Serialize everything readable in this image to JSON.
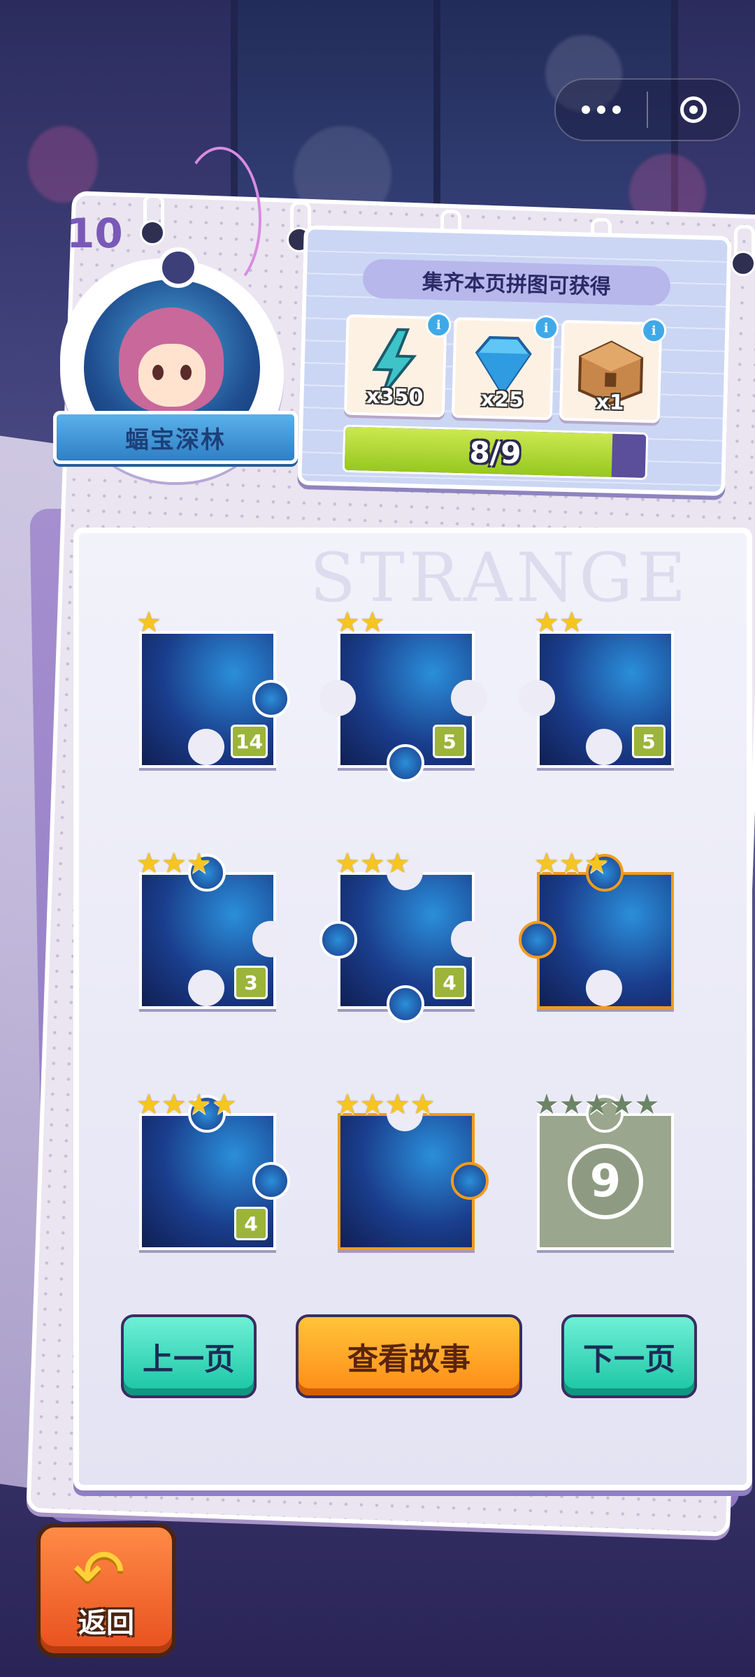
{
  "page": {
    "number": "10",
    "watermark": "STRANGE"
  },
  "avatar": {
    "label": "蝠宝深林"
  },
  "reward": {
    "title": "集齐本页拼图可获得",
    "items": [
      {
        "icon": "lightning-icon",
        "qty": "x350",
        "info": "i"
      },
      {
        "icon": "diamond-icon",
        "qty": "x25",
        "info": "i"
      },
      {
        "icon": "treasure-chest-icon",
        "qty": "x1",
        "info": "i"
      }
    ],
    "progress": {
      "text": "8/9",
      "fraction": 0.889
    }
  },
  "pieces": [
    {
      "stars": 1,
      "count": "14"
    },
    {
      "stars": 2,
      "count": "5"
    },
    {
      "stars": 2,
      "count": "5"
    },
    {
      "stars": 3,
      "count": "3"
    },
    {
      "stars": 3,
      "count": "4"
    },
    {
      "stars": 3,
      "count": ""
    },
    {
      "stars": 4,
      "count": "4"
    },
    {
      "stars": 4,
      "count": ""
    },
    {
      "stars": 5,
      "count": "",
      "locked_number": "9"
    }
  ],
  "buttons": {
    "prev": "上一页",
    "story": "查看故事",
    "next": "下一页",
    "back": "返回"
  },
  "colors": {
    "accent_orange": "#ff8a17",
    "teal": "#18c4a4",
    "purple": "#7a58b8",
    "progress_green": "#97c81f"
  }
}
